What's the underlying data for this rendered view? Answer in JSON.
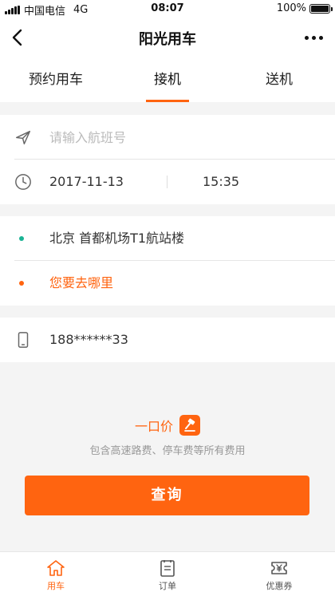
{
  "status_bar": {
    "carrier": "中国电信",
    "network": "4G",
    "time": "08:07",
    "battery": "100%",
    "battery_level": 1.0
  },
  "nav": {
    "title": "阳光用车",
    "back_icon": "chevron-left-icon",
    "more_icon": "more-dots-icon"
  },
  "tabs": [
    {
      "label": "预约用车",
      "active": false
    },
    {
      "label": "接机",
      "active": true
    },
    {
      "label": "送机",
      "active": false
    }
  ],
  "flight": {
    "placeholder": "请输入航班号",
    "value": "",
    "icon": "airplane-icon"
  },
  "datetime": {
    "date": "2017-11-13",
    "time": "15:35",
    "icon": "clock-icon"
  },
  "route": {
    "origin": "北京 首都机场T1航站楼",
    "destination": "您要去哪里",
    "origin_color": "#1ab394",
    "destination_color": "#ff6410"
  },
  "contact": {
    "phone": "188******33",
    "icon": "phone-icon"
  },
  "price": {
    "label": "一口价",
    "badge_icon": "hammer-icon",
    "subtitle": "包含高速路费、停车费等所有费用"
  },
  "query_button": {
    "label": "查询"
  },
  "bottom_nav": [
    {
      "label": "用车",
      "icon": "home-icon",
      "active": true
    },
    {
      "label": "订单",
      "icon": "order-list-icon",
      "active": false
    },
    {
      "label": "优惠券",
      "icon": "coupon-icon",
      "active": false
    }
  ],
  "colors": {
    "accent": "#ff6410",
    "origin_dot": "#1ab394"
  }
}
